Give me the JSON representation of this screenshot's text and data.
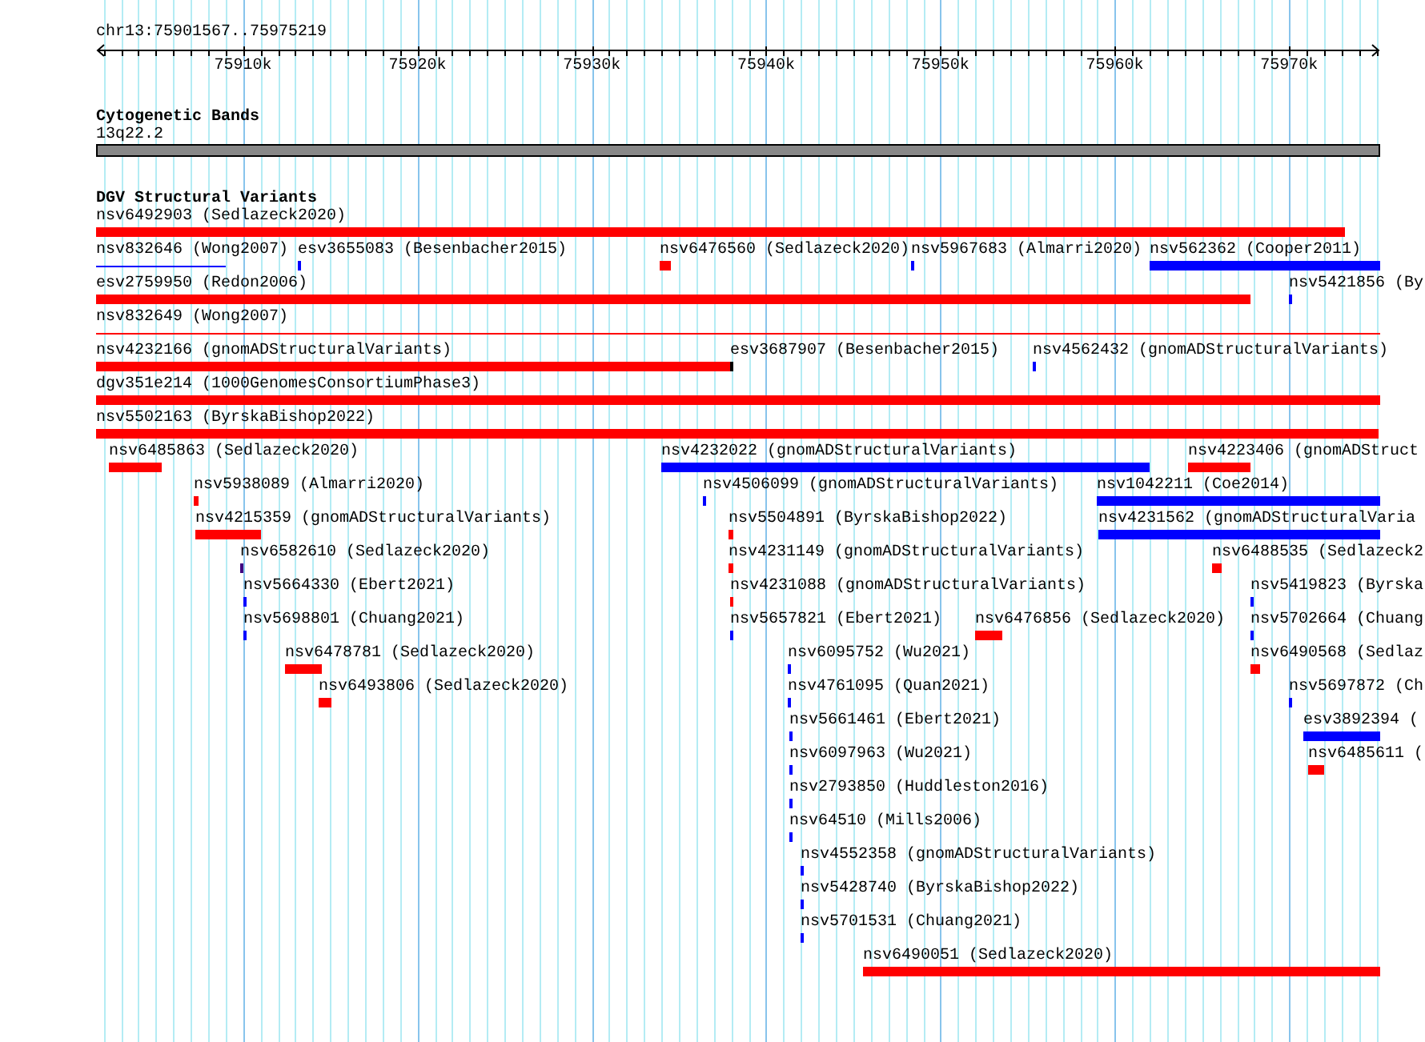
{
  "browser": {
    "location": "chr13:75901567..75975219",
    "ruler": {
      "ticks": [
        "75910k",
        "75920k",
        "75930k",
        "75940k",
        "75950k",
        "75960k",
        "75970k"
      ]
    },
    "tracks": [
      {
        "kind": "cytoband",
        "title": "Cytogenetic Bands",
        "band": "13q22.2"
      },
      {
        "kind": "variants",
        "title": "DGV Structural Variants",
        "lanes": [
          [
            {
              "label": "nsv6492903 (Sedlazeck2020)",
              "color": "#ff0000",
              "kind": "solid"
            }
          ],
          [
            {
              "label": "nsv832646 (Wong2007)",
              "color": "#0000ff",
              "kind": "thin"
            },
            {
              "label": "esv3655083 (Besenbacher2015)",
              "color": "#0000ff",
              "kind": "solid"
            },
            {
              "label": "nsv6476560 (Sedlazeck2020)",
              "color": "#ff0000",
              "kind": "solid"
            },
            {
              "label": "nsv5967683 (Almarri2020)",
              "color": "#0000ff",
              "kind": "solid"
            },
            {
              "label": "nsv562362 (Cooper2011)",
              "color": "#0000ff",
              "kind": "solid"
            }
          ],
          [
            {
              "label": "esv2759950 (Redon2006)",
              "color": "#ff0000",
              "kind": "solid"
            },
            {
              "label": "nsv5421856 (By",
              "color": "#0000ff",
              "kind": "solid"
            }
          ],
          [
            {
              "label": "nsv832649 (Wong2007)",
              "color": "#ff0000",
              "kind": "thin"
            }
          ],
          [
            {
              "label": "nsv4232166 (gnomADStructuralVariants)",
              "color": "#ff0000",
              "kind": "solid"
            },
            {
              "label": "esv3687907 (Besenbacher2015)",
              "color": "#000000",
              "kind": "solid"
            },
            {
              "label": "nsv4562432 (gnomADStructuralVariants)",
              "color": "#0000ff",
              "kind": "solid"
            }
          ],
          [
            {
              "label": "dgv351e214 (1000GenomesConsortiumPhase3)",
              "color": "#ff0000",
              "kind": "solid"
            }
          ],
          [
            {
              "label": "nsv5502163 (ByrskaBishop2022)",
              "color": "#ff0000",
              "kind": "solid"
            }
          ],
          [
            {
              "label": "nsv6485863 (Sedlazeck2020)",
              "color": "#ff0000",
              "kind": "solid"
            },
            {
              "label": "nsv4232022 (gnomADStructuralVariants)",
              "color": "#0000ff",
              "kind": "solid"
            },
            {
              "label": "nsv4223406 (gnomADStruct",
              "color": "#ff0000",
              "kind": "solid"
            }
          ],
          [
            {
              "label": "nsv5938089 (Almarri2020)",
              "color": "#ff0000",
              "kind": "solid"
            },
            {
              "label": "nsv4506099 (gnomADStructuralVariants)",
              "color": "#0000ff",
              "kind": "solid"
            },
            {
              "label": "nsv1042211 (Coe2014)",
              "color": "#0000ff",
              "kind": "solid"
            }
          ],
          [
            {
              "label": "nsv4215359 (gnomADStructuralVariants)",
              "color": "#ff0000",
              "kind": "solid"
            },
            {
              "label": "nsv5504891 (ByrskaBishop2022)",
              "color": "#ff0000",
              "kind": "solid"
            },
            {
              "label": "nsv4231562 (gnomADStructuralVaria",
              "color": "#0000ff",
              "kind": "solid"
            }
          ],
          [
            {
              "label": "nsv6582610 (Sedlazeck2020)",
              "color": "#400080",
              "kind": "solid"
            },
            {
              "label": "nsv4231149 (gnomADStructuralVariants)",
              "color": "#ff0000",
              "kind": "solid"
            },
            {
              "label": "nsv6488535 (Sedlazeck2",
              "color": "#ff0000",
              "kind": "solid"
            }
          ],
          [
            {
              "label": "nsv5664330 (Ebert2021)",
              "color": "#0000ff",
              "kind": "solid"
            },
            {
              "label": "nsv4231088 (gnomADStructuralVariants)",
              "color": "#ff0000",
              "kind": "solid"
            },
            {
              "label": "nsv5419823 (Byrska",
              "color": "#0000ff",
              "kind": "solid"
            }
          ],
          [
            {
              "label": "nsv5698801 (Chuang2021)",
              "color": "#0000ff",
              "kind": "solid"
            },
            {
              "label": "nsv5657821 (Ebert2021)",
              "color": "#0000ff",
              "kind": "solid"
            },
            {
              "label": "nsv6476856 (Sedlazeck2020)",
              "color": "#ff0000",
              "kind": "solid"
            },
            {
              "label": "nsv5702664 (Chuang",
              "color": "#0000ff",
              "kind": "solid"
            }
          ],
          [
            {
              "label": "nsv6478781 (Sedlazeck2020)",
              "color": "#ff0000",
              "kind": "solid"
            },
            {
              "label": "nsv6095752 (Wu2021)",
              "color": "#0000ff",
              "kind": "solid"
            },
            {
              "label": "nsv6490568 (Sedlaz",
              "color": "#ff0000",
              "kind": "solid"
            }
          ],
          [
            {
              "label": "nsv6493806 (Sedlazeck2020)",
              "color": "#ff0000",
              "kind": "solid"
            },
            {
              "label": "nsv4761095 (Quan2021)",
              "color": "#0000ff",
              "kind": "solid"
            },
            {
              "label": "nsv5697872 (Ch",
              "color": "#0000ff",
              "kind": "solid"
            }
          ],
          [
            {
              "label": "nsv5661461 (Ebert2021)",
              "color": "#0000ff",
              "kind": "solid"
            },
            {
              "label": "esv3892394 (",
              "color": "#0000ff",
              "kind": "solid"
            }
          ],
          [
            {
              "label": "nsv6097963 (Wu2021)",
              "color": "#0000ff",
              "kind": "solid"
            },
            {
              "label": "nsv6485611 (",
              "color": "#ff0000",
              "kind": "solid"
            }
          ],
          [
            {
              "label": "nsv2793850 (Huddleston2016)",
              "color": "#0000ff",
              "kind": "solid"
            }
          ],
          [
            {
              "label": "nsv64510 (Mills2006)",
              "color": "#0000ff",
              "kind": "solid"
            }
          ],
          [
            {
              "label": "nsv4552358 (gnomADStructuralVariants)",
              "color": "#0000ff",
              "kind": "solid"
            }
          ],
          [
            {
              "label": "nsv5428740 (ByrskaBishop2022)",
              "color": "#0000ff",
              "kind": "solid"
            }
          ],
          [
            {
              "label": "nsv5701531 (Chuang2021)",
              "color": "#0000ff",
              "kind": "solid"
            }
          ],
          [
            {
              "label": "nsv6490051 (Sedlazeck2020)",
              "color": "#ff0000",
              "kind": "solid"
            }
          ]
        ]
      }
    ]
  }
}
